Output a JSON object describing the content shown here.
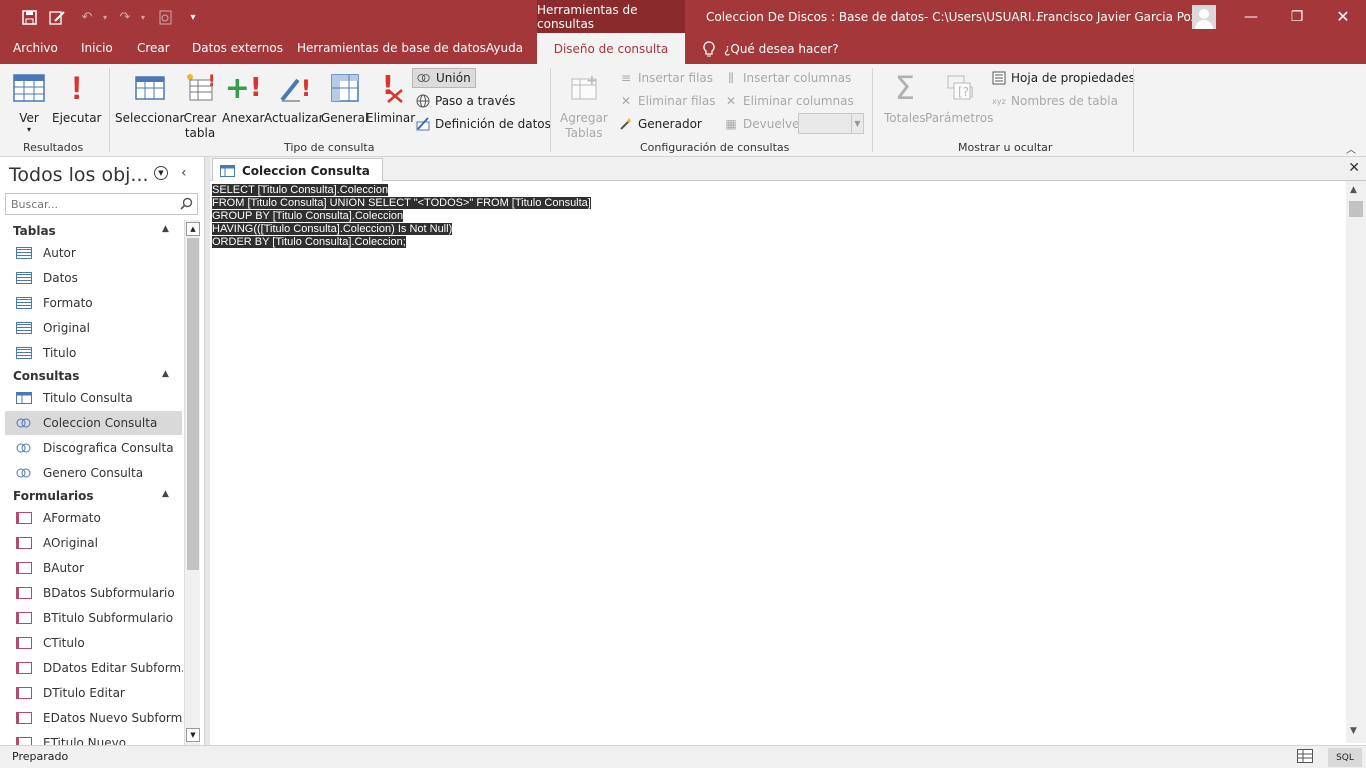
{
  "titlebar": {
    "context_tools": "Herramientas de consultas",
    "document_title": "Coleccion De Discos : Base de datos- C:\\Users\\USUARI...",
    "user_name": "Francisco Javier Garcia Poza"
  },
  "tabs": {
    "archivo": "Archivo",
    "inicio": "Inicio",
    "crear": "Crear",
    "datos_externos": "Datos externos",
    "herramientas": "Herramientas de base de datos",
    "ayuda": "Ayuda",
    "diseno": "Diseño de consulta",
    "tellme": "¿Qué desea hacer?"
  },
  "ribbon": {
    "resultados": {
      "label": "Resultados",
      "ver": "Ver",
      "ejecutar": "Ejecutar"
    },
    "tipo": {
      "label": "Tipo de consulta",
      "seleccionar": "Seleccionar",
      "crear": "Crear",
      "tabla": "tabla",
      "anexar": "Anexar",
      "actualizar": "Actualizar",
      "general": "General",
      "eliminar": "Eliminar",
      "union": "Unión",
      "paso": "Paso a través",
      "definicion": "Definición de datos"
    },
    "config": {
      "label": "Configuración de consultas",
      "agregar": "Agregar",
      "tablas": "Tablas",
      "insertar_filas": "Insertar filas",
      "eliminar_filas": "Eliminar filas",
      "generador": "Generador",
      "insertar_columnas": "Insertar columnas",
      "eliminar_columnas": "Eliminar columnas",
      "devuelve": "Devuelve:"
    },
    "mostrar": {
      "label": "Mostrar u ocultar",
      "totales": "Totales",
      "parametros": "Parámetros",
      "hoja": "Hoja de propiedades",
      "nombres": "Nombres de tabla"
    }
  },
  "nav": {
    "title": "Todos los obj...",
    "search_placeholder": "Buscar...",
    "sections": {
      "tablas": "Tablas",
      "consultas": "Consultas",
      "formularios": "Formularios"
    },
    "tablas": [
      "Autor",
      "Datos",
      "Formato",
      "Original",
      "Titulo"
    ],
    "consultas": [
      "Titulo Consulta",
      "Coleccion Consulta",
      "Discografica Consulta",
      "Genero Consulta"
    ],
    "formularios": [
      "AFormato",
      "AOriginal",
      "BAutor",
      "BDatos Subformulario",
      "BTitulo Subformulario",
      "CTitulo",
      "DDatos Editar Subform...",
      "DTitulo Editar",
      "EDatos Nuevo Subform...",
      "ETitulo Nuevo"
    ]
  },
  "document": {
    "tab_label": "Coleccion Consulta",
    "sql": [
      "SELECT [Titulo Consulta].Coleccion",
      "FROM [Titulo Consulta] UNION SELECT \"<TODOS>\" FROM [Titulo Consulta]",
      "GROUP BY [Titulo Consulta].Coleccion",
      "HAVING(([Titulo Consulta].Coleccion) Is Not Null)",
      "ORDER BY [Titulo Consulta].Coleccion;"
    ]
  },
  "status": {
    "text": "Preparado",
    "view": "SQL"
  }
}
